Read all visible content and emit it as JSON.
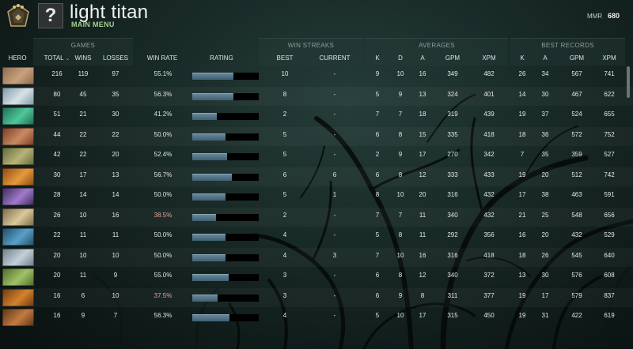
{
  "header": {
    "avatar_placeholder": "?",
    "player_name": "light titan",
    "menu_link": "MAIN MENU",
    "mmr_label": "MMR",
    "mmr_value": "680"
  },
  "groups": {
    "games": "GAMES",
    "win_streaks": "WIN STREAKS",
    "averages": "AVERAGES",
    "best_records": "BEST RECORDS"
  },
  "columns": {
    "hero": "HERO",
    "total": "TOTAL",
    "sort_indicator": "⌄",
    "wins": "WINS",
    "losses": "LOSSES",
    "win_rate": "WIN RATE",
    "rating": "RATING",
    "best": "BEST",
    "current": "CURRENT",
    "avg_k": "K",
    "avg_d": "D",
    "avg_a": "A",
    "avg_gpm": "GPM",
    "avg_xpm": "XPM",
    "best_k": "K",
    "best_a": "A",
    "best_gpm": "GPM",
    "best_xpm": "XPM"
  },
  "colors": {
    "win_rate_low": "#e7a292",
    "rating_bar": "#5a7a8e",
    "menu_link": "#9fd08a"
  },
  "rows": [
    {
      "portrait": [
        "#8a6a55",
        "#c9a27c"
      ],
      "total": "216",
      "wins": "119",
      "losses": "97",
      "win_rate": "55.1%",
      "rating": 0.62,
      "best": "10",
      "current": "-",
      "k": "9",
      "d": "10",
      "a": "16",
      "gpm": "349",
      "xpm": "482",
      "bk": "26",
      "ba": "34",
      "bgpm": "567",
      "bxpm": "741"
    },
    {
      "portrait": [
        "#7d9aa8",
        "#d8e2e6"
      ],
      "total": "80",
      "wins": "45",
      "losses": "35",
      "win_rate": "56.3%",
      "rating": 0.62,
      "best": "8",
      "current": "-",
      "k": "5",
      "d": "9",
      "a": "13",
      "gpm": "324",
      "xpm": "401",
      "bk": "14",
      "ba": "30",
      "bgpm": "467",
      "bxpm": "622"
    },
    {
      "portrait": [
        "#1f6b52",
        "#4fc79a"
      ],
      "total": "51",
      "wins": "21",
      "losses": "30",
      "win_rate": "41.2%",
      "rating": 0.37,
      "best": "2",
      "current": "-",
      "k": "7",
      "d": "7",
      "a": "18",
      "gpm": "319",
      "xpm": "439",
      "bk": "19",
      "ba": "37",
      "bgpm": "524",
      "bxpm": "655"
    },
    {
      "portrait": [
        "#7a3b26",
        "#c98a62"
      ],
      "total": "44",
      "wins": "22",
      "losses": "22",
      "win_rate": "50.0%",
      "rating": 0.5,
      "best": "5",
      "current": "-",
      "k": "6",
      "d": "8",
      "a": "15",
      "gpm": "335",
      "xpm": "418",
      "bk": "18",
      "ba": "36",
      "bgpm": "572",
      "bxpm": "752"
    },
    {
      "portrait": [
        "#5f6b3a",
        "#b9b277"
      ],
      "total": "42",
      "wins": "22",
      "losses": "20",
      "win_rate": "52.4%",
      "rating": 0.52,
      "best": "5",
      "current": "-",
      "k": "2",
      "d": "9",
      "a": "17",
      "gpm": "270",
      "xpm": "342",
      "bk": "7",
      "ba": "35",
      "bgpm": "359",
      "bxpm": "527"
    },
    {
      "portrait": [
        "#8a4a16",
        "#e69a3a"
      ],
      "total": "30",
      "wins": "17",
      "losses": "13",
      "win_rate": "56.7%",
      "rating": 0.6,
      "best": "6",
      "current": "6",
      "k": "6",
      "d": "8",
      "a": "12",
      "gpm": "333",
      "xpm": "433",
      "bk": "19",
      "ba": "20",
      "bgpm": "512",
      "bxpm": "742"
    },
    {
      "portrait": [
        "#3c2a5a",
        "#a07acb"
      ],
      "total": "28",
      "wins": "14",
      "losses": "14",
      "win_rate": "50.0%",
      "rating": 0.5,
      "best": "5",
      "current": "1",
      "k": "8",
      "d": "10",
      "a": "20",
      "gpm": "316",
      "xpm": "432",
      "bk": "17",
      "ba": "38",
      "bgpm": "463",
      "bxpm": "591"
    },
    {
      "portrait": [
        "#7a6a4a",
        "#dcc79a"
      ],
      "total": "26",
      "wins": "10",
      "losses": "16",
      "win_rate": "38.5%",
      "win_rate_low": true,
      "rating": 0.36,
      "best": "2",
      "current": "-",
      "k": "7",
      "d": "7",
      "a": "11",
      "gpm": "340",
      "xpm": "432",
      "bk": "21",
      "ba": "25",
      "bgpm": "548",
      "bxpm": "656"
    },
    {
      "portrait": [
        "#1f4a66",
        "#5aa0c8"
      ],
      "total": "22",
      "wins": "11",
      "losses": "11",
      "win_rate": "50.0%",
      "rating": 0.5,
      "best": "4",
      "current": "-",
      "k": "5",
      "d": "8",
      "a": "11",
      "gpm": "292",
      "xpm": "356",
      "bk": "16",
      "ba": "20",
      "bgpm": "432",
      "bxpm": "529"
    },
    {
      "portrait": [
        "#6d7e8a",
        "#c3d0d8"
      ],
      "total": "20",
      "wins": "10",
      "losses": "10",
      "win_rate": "50.0%",
      "rating": 0.5,
      "best": "4",
      "current": "3",
      "k": "7",
      "d": "10",
      "a": "16",
      "gpm": "316",
      "xpm": "418",
      "bk": "18",
      "ba": "26",
      "bgpm": "545",
      "bxpm": "640"
    },
    {
      "portrait": [
        "#4d6a2a",
        "#9fc266"
      ],
      "total": "20",
      "wins": "11",
      "losses": "9",
      "win_rate": "55.0%",
      "rating": 0.55,
      "best": "3",
      "current": "-",
      "k": "6",
      "d": "8",
      "a": "12",
      "gpm": "340",
      "xpm": "372",
      "bk": "13",
      "ba": "30",
      "bgpm": "576",
      "bxpm": "608"
    },
    {
      "portrait": [
        "#6a3a12",
        "#d4822c"
      ],
      "total": "16",
      "wins": "6",
      "losses": "10",
      "win_rate": "37.5%",
      "win_rate_low": true,
      "rating": 0.38,
      "best": "3",
      "current": "-",
      "k": "6",
      "d": "9",
      "a": "8",
      "gpm": "311",
      "xpm": "377",
      "bk": "19",
      "ba": "17",
      "bgpm": "579",
      "bxpm": "837"
    },
    {
      "portrait": [
        "#5a3418",
        "#c27a3e"
      ],
      "total": "16",
      "wins": "9",
      "losses": "7",
      "win_rate": "56.3%",
      "rating": 0.56,
      "best": "4",
      "current": "-",
      "k": "5",
      "d": "10",
      "a": "17",
      "gpm": "315",
      "xpm": "450",
      "bk": "19",
      "ba": "31",
      "bgpm": "422",
      "bxpm": "619"
    }
  ]
}
